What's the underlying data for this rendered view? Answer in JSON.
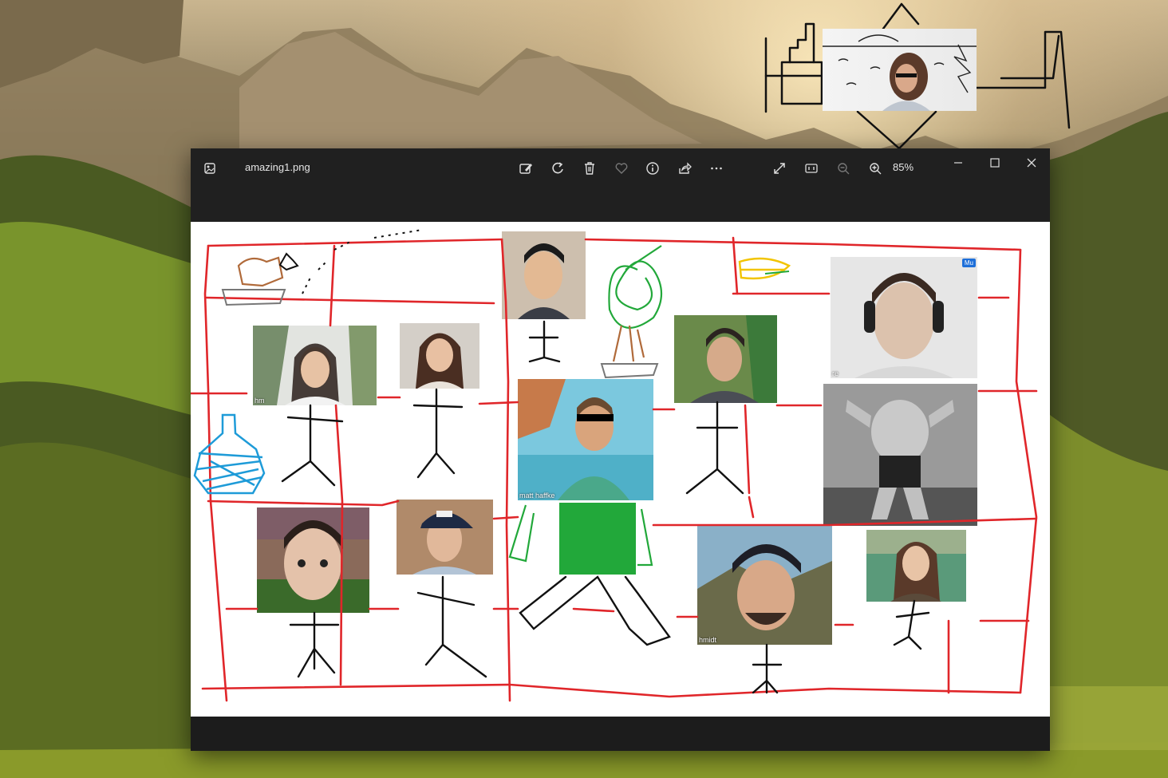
{
  "window": {
    "filename": "amazing1.png",
    "zoom": "85%"
  },
  "toolbar": {
    "icons": [
      "image-icon",
      "edit-icon",
      "rotate-icon",
      "delete-icon",
      "favorite-icon",
      "info-icon",
      "share-icon",
      "more-icon",
      "fullscreen-icon",
      "actual-size-icon",
      "zoom-out-icon",
      "zoom-in-icon"
    ]
  },
  "window_controls": [
    "minimize-icon",
    "maximize-icon",
    "close-icon"
  ],
  "participants": [
    {
      "name": "hm"
    },
    {
      "name": "matt haffke"
    },
    {
      "name": "hmidt"
    },
    {
      "name": "re"
    },
    {
      "name": "Mu"
    }
  ],
  "colors": {
    "drawing_red": "#e0262a",
    "drawing_green": "#22a83a",
    "drawing_blue": "#1e9bd8",
    "drawing_brown": "#b06a3a",
    "drawing_yellow": "#f2c400",
    "window_bg": "#202020",
    "badge_blue": "#1e6fd9"
  }
}
